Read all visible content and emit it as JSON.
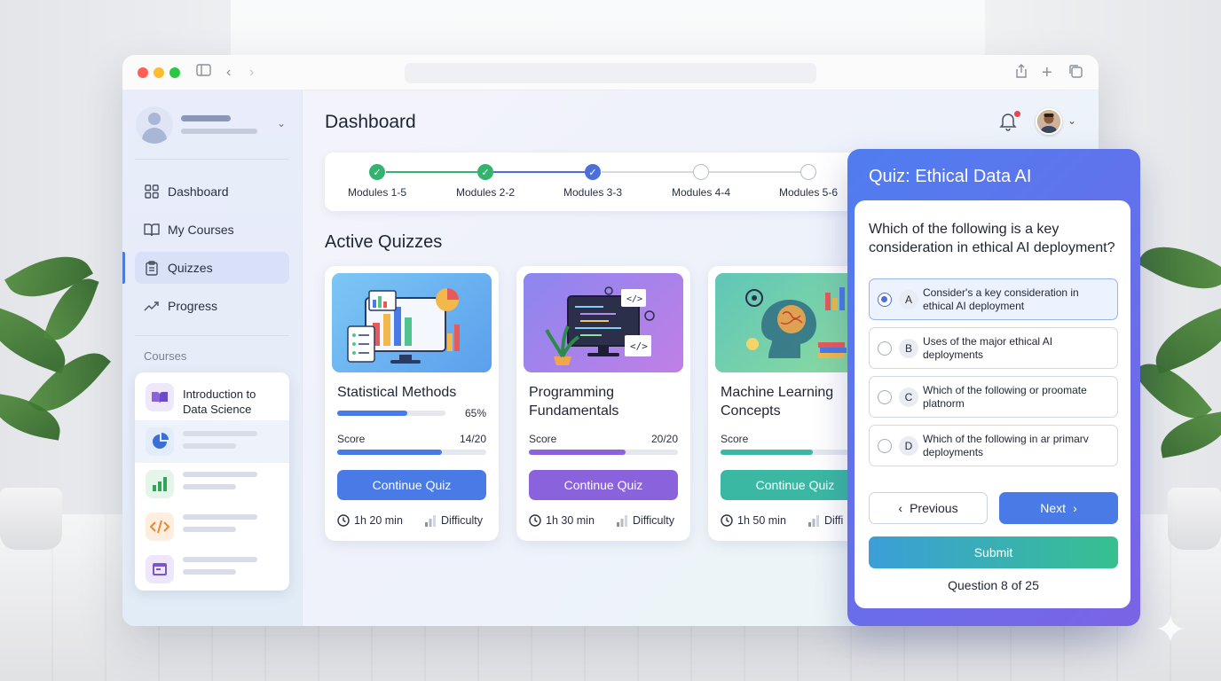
{
  "sidebar": {
    "nav": [
      {
        "label": "Dashboard",
        "icon": "grid-icon"
      },
      {
        "label": "My Courses",
        "icon": "book-open-icon"
      },
      {
        "label": "Quizzes",
        "icon": "clipboard-icon"
      },
      {
        "label": "Progress",
        "icon": "trend-up-icon"
      }
    ],
    "active": "Quizzes",
    "courses_label": "Courses",
    "courses": [
      {
        "title": "Introduction to Data Science",
        "icon": "book-icon"
      }
    ]
  },
  "header": {
    "title": "Dashboard"
  },
  "stepper": {
    "steps": [
      {
        "label": "Modules 1-5",
        "state": "done"
      },
      {
        "label": "Modules 2-2",
        "state": "done"
      },
      {
        "label": "Modules 3-3",
        "state": "current"
      },
      {
        "label": "Modules 4-4",
        "state": "todo"
      },
      {
        "label": "Modules 5-6",
        "state": "todo"
      }
    ]
  },
  "active_quizzes": {
    "title": "Active Quizzes",
    "cards": [
      {
        "title": "Statistical Methods",
        "progress_text": "65%",
        "progress": 0.65,
        "score_label": "Score",
        "score": "14/20",
        "score_fill": 0.7,
        "button": "Continue Quiz",
        "time": "1h 20 min",
        "difficulty": "Difficulty",
        "color": "#4a7ae6"
      },
      {
        "title": "Programming Fundamentals",
        "score_label": "Score",
        "score": "20/20",
        "score_fill": 0.65,
        "button": "Continue Quiz",
        "time": "1h 30 min",
        "difficulty": "Difficulty",
        "color": "#8a63dc"
      },
      {
        "title": "Machine Learning Concepts",
        "score_label": "Score",
        "score_fill": 0.62,
        "button": "Continue Quiz",
        "time": "1h 50 min",
        "difficulty": "Diffi",
        "color": "#3bb8a3"
      }
    ]
  },
  "quiz": {
    "title": "Quiz: Ethical Data AI",
    "question": "Which of the following is a key consideration in ethical AI deployment?",
    "options": [
      {
        "letter": "A",
        "text": "Consider's a key consideration in ethical AI deployment",
        "selected": true
      },
      {
        "letter": "B",
        "text": "Uses of the major ethical AI deployments",
        "selected": false
      },
      {
        "letter": "C",
        "text": "Which of the following or proomate platnorm",
        "selected": false
      },
      {
        "letter": "D",
        "text": "Which of the following in ar primarv deployments",
        "selected": false
      }
    ],
    "previous": "Previous",
    "next": "Next",
    "submit": "Submit",
    "counter": "Question 8 of 25"
  }
}
